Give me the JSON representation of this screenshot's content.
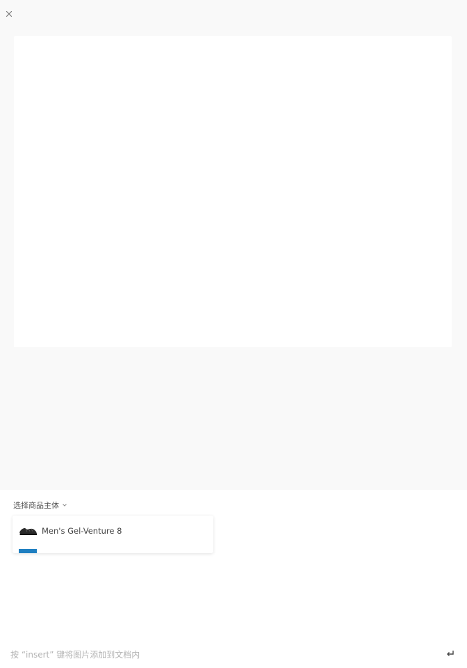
{
  "window": {
    "close_icon": "close-icon"
  },
  "subject": {
    "label": "选择商品主体",
    "chevron_icon": "chevron-down-icon"
  },
  "dropdown": {
    "items": [
      {
        "label": "Men's Gel-Venture 8",
        "thumbnail": "shoe-thumbnail"
      }
    ]
  },
  "footer": {
    "hint": "按 “insert” 键将图片添加到文档内",
    "enter_icon": "enter-icon"
  },
  "colors": {
    "preview_bg": "#ffffff",
    "page_bg": "#f9f9f9",
    "accent": "#1f7fc1",
    "hint": "#b3b3b3"
  }
}
